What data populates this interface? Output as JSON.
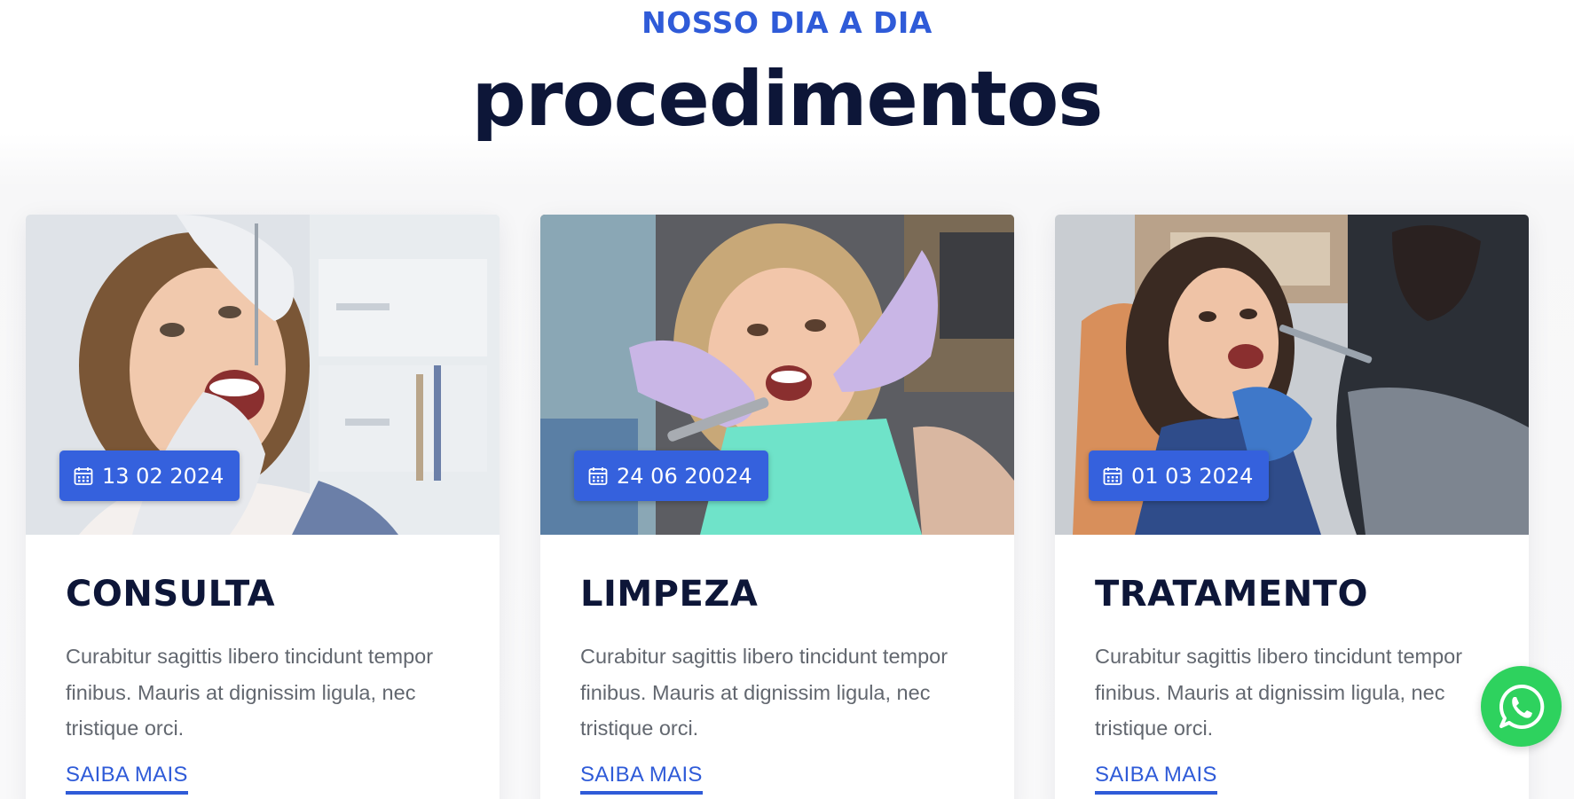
{
  "section": {
    "label": "NOSSO DIA A DIA",
    "title": "procedimentos"
  },
  "cards": [
    {
      "date": "13 02 2024",
      "title": "CONSULTA",
      "text": "Curabitur sagittis libero tincidunt tempor finibus. Mauris at dignissim ligula, nec tristique orci.",
      "link": "SAIBA MAIS",
      "photo": "dental-consultation-photo"
    },
    {
      "date": "24 06 20024",
      "title": "LIMPEZA",
      "text": "Curabitur sagittis libero tincidunt tempor finibus. Mauris at dignissim ligula, nec tristique orci.",
      "link": "SAIBA MAIS",
      "photo": "child-dental-cleaning-photo"
    },
    {
      "date": "01 03 2024",
      "title": "TRATAMENTO",
      "text": "Curabitur sagittis libero tincidunt tempor finibus. Mauris at dignissim ligula, nec tristique orci.",
      "link": "SAIBA MAIS",
      "photo": "dental-treatment-photo"
    }
  ],
  "icons": {
    "date": "calendar-icon",
    "floating_button": "whatsapp-icon"
  },
  "colors": {
    "accent": "#3561dd",
    "heading": "#0d1638",
    "body_text": "#62676f",
    "whatsapp": "#2ed25e"
  }
}
